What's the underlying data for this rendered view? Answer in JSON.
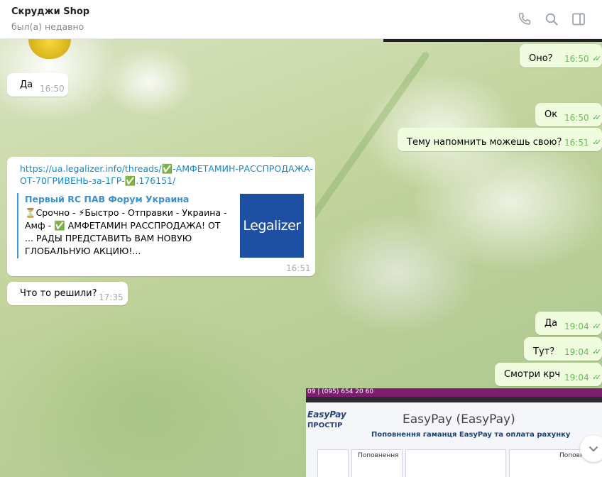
{
  "header": {
    "title": "Скруджи Shop",
    "status": "был(а) недавно",
    "icons": [
      "phone-icon",
      "search-icon",
      "sidebar-toggle-icon"
    ]
  },
  "messages": [
    {
      "id": "m1",
      "dir": "out",
      "text": "Оно？",
      "time": "16:50"
    },
    {
      "id": "m2",
      "dir": "in",
      "text": "Да",
      "time": "16:50"
    },
    {
      "id": "m3",
      "dir": "out",
      "text": "Ок",
      "time": "16:50"
    },
    {
      "id": "m4",
      "dir": "out",
      "text": "Тему напомнить можешь свою？",
      "time": "16:51"
    },
    {
      "id": "m5",
      "dir": "in",
      "time": "16:51",
      "link_line1": "https://ua.legalizer.info/threads/✅-АМФЕТАМИН-РАССПРОДАЖА-",
      "link_line2": "ОТ-70ГРИВЕНЬ-за-1ГР-✅.176151/",
      "preview_title": "Первый RC ПАВ Форум Украина",
      "preview_desc": "⏳Срочно - ⚡Быстро - Отправки - Украина - Амф - ✅ АМФЕТАМИН РАССПРОДАЖА! ОТ ... РАДЫ ПРЕДСТАВИТЬ ВАМ НОВУЮ ГЛОБАЛЬНУЮ АКЦИЮ!...",
      "thumb_text": "Legalizer"
    },
    {
      "id": "m6",
      "dir": "in",
      "text": "Что то решили?",
      "time": "17:35"
    },
    {
      "id": "m7",
      "dir": "out",
      "text": "Да",
      "time": "19:04"
    },
    {
      "id": "m8",
      "dir": "out",
      "text": "Тут？",
      "time": "19:04"
    },
    {
      "id": "m9",
      "dir": "out",
      "text": "Смотри крч",
      "time": "19:04"
    }
  ],
  "photo": {
    "topbar_text": "09 | (095) 654 20 60",
    "logo": "EasyPay",
    "logo_sub": "ПРОСТІР",
    "screen_title": "EasyPay (EasyPay)",
    "caption": "Поповнення гаманця EasyPay та оплата рахунку",
    "tile1": "Поповнення",
    "tile2": "Поповнення"
  },
  "colors": {
    "outgoing_bubble": "#effdde",
    "incoming_bubble": "#ffffff",
    "link": "#168acd",
    "check": "#4fae4e"
  }
}
